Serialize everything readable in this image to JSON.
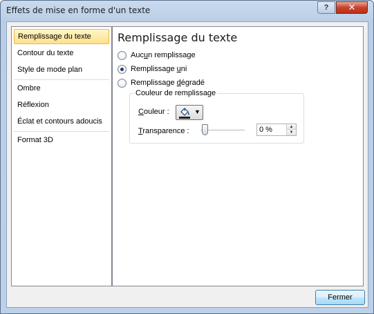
{
  "window": {
    "title": "Effets de mise en forme d'un texte",
    "help_label": "?",
    "close_label": "✕"
  },
  "sidebar": {
    "items": [
      {
        "label": "Remplissage du texte",
        "selected": true
      },
      {
        "label": "Contour du texte"
      },
      {
        "label": "Style de mode plan"
      },
      {
        "label": "Ombre"
      },
      {
        "label": "Réflexion"
      },
      {
        "label": "Éclat et contours adoucis"
      },
      {
        "label": "Format 3D"
      }
    ]
  },
  "content": {
    "title": "Remplissage du texte",
    "options": [
      {
        "label_pre": "Auc",
        "label_u": "u",
        "label_post": "n remplissage",
        "selected": false
      },
      {
        "label_pre": "Remplissage ",
        "label_u": "u",
        "label_post": "ni",
        "selected": true
      },
      {
        "label_pre": "Remplissage ",
        "label_u": "d",
        "label_post": "égradé",
        "selected": false
      }
    ],
    "group": {
      "title": "Couleur de remplissage",
      "color_label_u": "C",
      "color_label_post": "ouleur :",
      "transparency_label_u": "T",
      "transparency_label_post": "ransparence :",
      "transparency_value": "0 %",
      "transparency_percent": 0
    }
  },
  "footer": {
    "close_button": "Fermer"
  },
  "colors": {
    "selected_bg": "#ffe08a",
    "fill_color": "#1f1f1f"
  }
}
